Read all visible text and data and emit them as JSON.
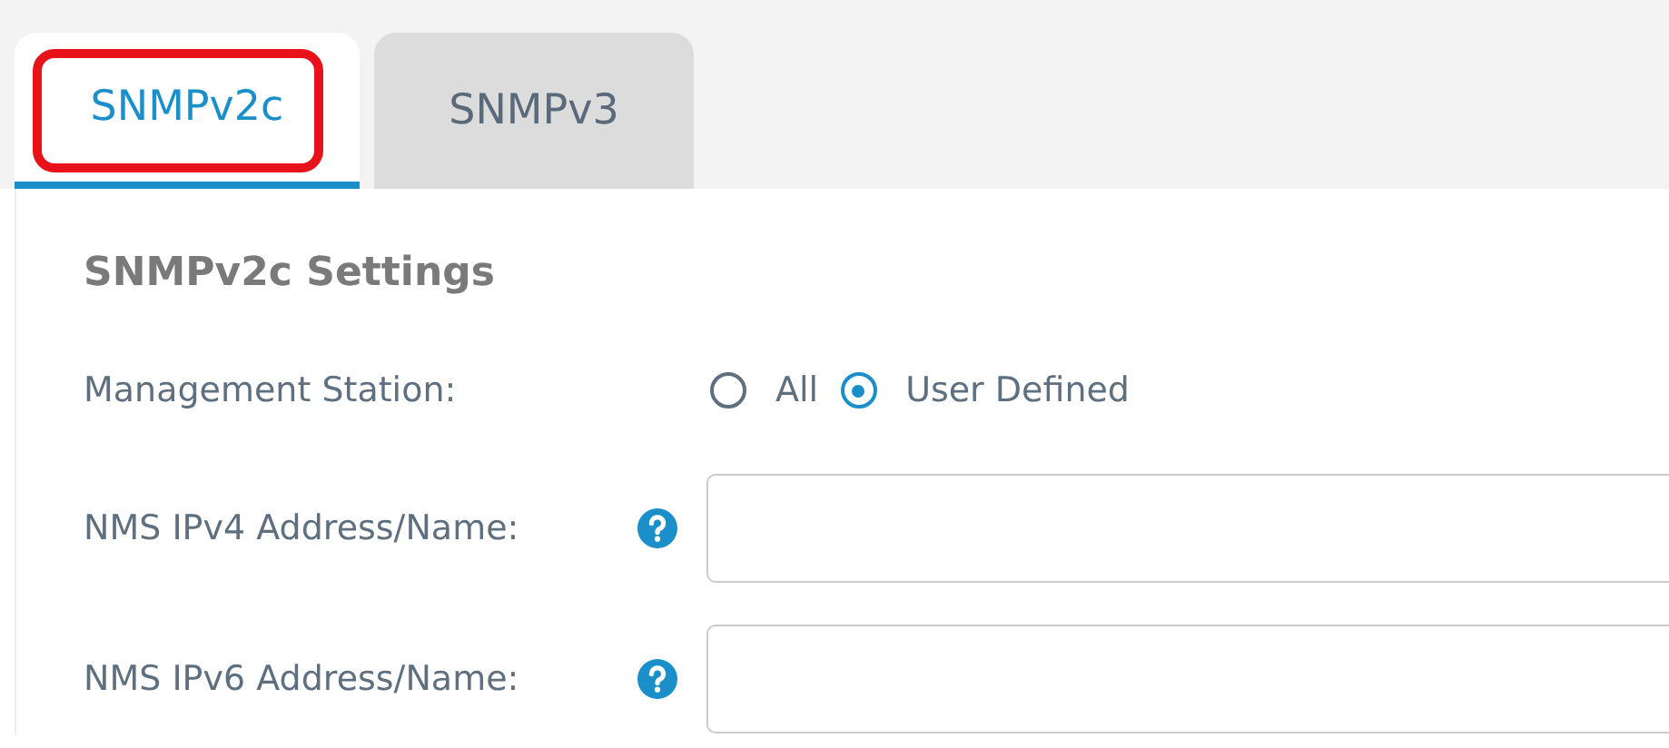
{
  "tabs": [
    {
      "label": "SNMPv2c",
      "selected": true,
      "highlighted": true
    },
    {
      "label": "SNMPv3",
      "selected": false,
      "highlighted": false
    }
  ],
  "section": {
    "title": "SNMPv2c Settings",
    "management_station": {
      "label": "Management Station:",
      "options": [
        {
          "label": "All",
          "selected": false
        },
        {
          "label": "User Defined",
          "selected": true
        }
      ]
    },
    "fields": [
      {
        "label": "NMS IPv4 Address/Name:"
      },
      {
        "label": "NMS IPv6 Address/Name:"
      }
    ]
  }
}
